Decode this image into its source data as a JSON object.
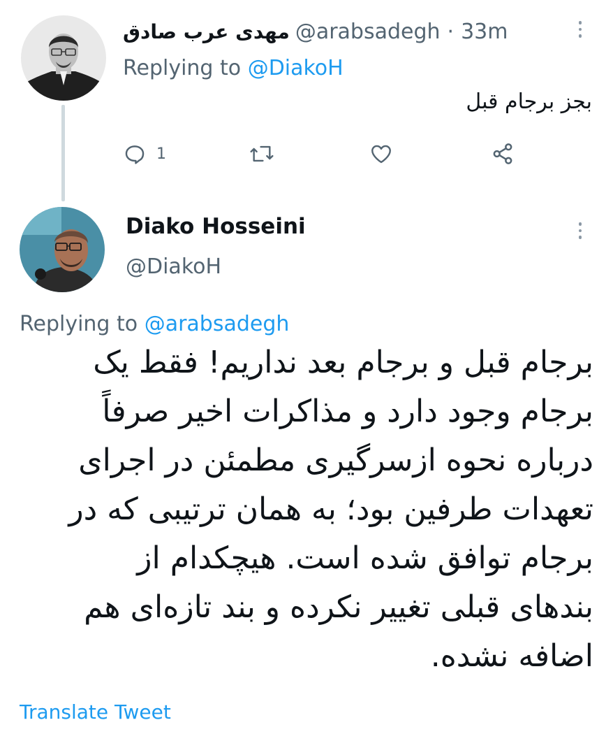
{
  "tweet1": {
    "display_name": "مهدی عرب صادق",
    "handle": "@arabsadegh",
    "separator": "·",
    "time": "33m",
    "replying_prefix": "Replying to",
    "replying_mention": "@DiakoH",
    "text": "بجز برجام قبل",
    "reply_count": "1"
  },
  "tweet2": {
    "display_name": "Diako Hosseini",
    "handle": "@DiakoH",
    "replying_prefix": "Replying to",
    "replying_mention": "@arabsadegh",
    "body_lines": [
      "برجام قبل و برجام بعد نداریم! فقط یک",
      "برجام وجود دارد و مذاکرات اخیر صرفاً",
      "درباره نحوه ازسرگیری مطمئن در اجرای",
      "تعهدات طرفین بود؛ به همان ترتیبی که در",
      "برجام توافق شده است. هیچکدام از",
      "بندهای قبلی تغییر نکرده و بند تازه‌ای هم",
      "اضافه نشده."
    ],
    "translate_label": "Translate Tweet"
  },
  "icons": {
    "reply": "reply-icon",
    "retweet": "retweet-icon",
    "like": "heart-icon",
    "share": "share-icon",
    "more": "more-vertical-icon"
  },
  "colors": {
    "link": "#1d9bf0",
    "muted": "#536471",
    "text": "#0f1419",
    "thread_line": "#cfd9de"
  }
}
